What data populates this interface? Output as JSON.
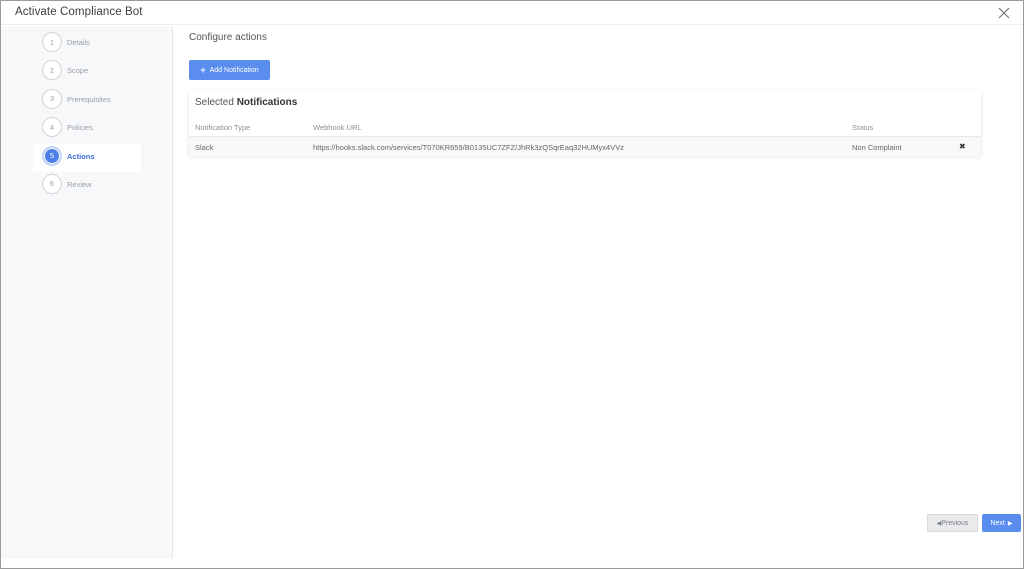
{
  "window": {
    "title": "Activate Compliance Bot"
  },
  "steps": [
    {
      "number": "1",
      "label": "Details"
    },
    {
      "number": "2",
      "label": "Scope"
    },
    {
      "number": "3",
      "label": "Prerequisites"
    },
    {
      "number": "4",
      "label": "Policies"
    },
    {
      "number": "5",
      "label": "Actions"
    },
    {
      "number": "6",
      "label": "Review"
    }
  ],
  "active_step": "Actions",
  "main": {
    "section_title": "Configure actions",
    "add_button_label": "Add Notification",
    "card": {
      "title_prefix": "Selected",
      "title_bold": "Notifications",
      "columns": [
        "Notification Type",
        "Webhook URL",
        "Status"
      ],
      "rows": [
        {
          "type": "Slack",
          "url": "https://hooks.slack.com/services/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",
          "status": "Non Complaint"
        }
      ]
    }
  },
  "footer": {
    "previous_label": "Previous",
    "next_label": "Next"
  },
  "colors": {
    "accent": "#5b8def",
    "active_step": "#3d6fd9"
  },
  "icons": {
    "close": "close-icon",
    "plus": "plus-icon",
    "remove": "remove-icon",
    "prev_caret": "caret-left-icon",
    "next_caret": "caret-right-icon"
  }
}
